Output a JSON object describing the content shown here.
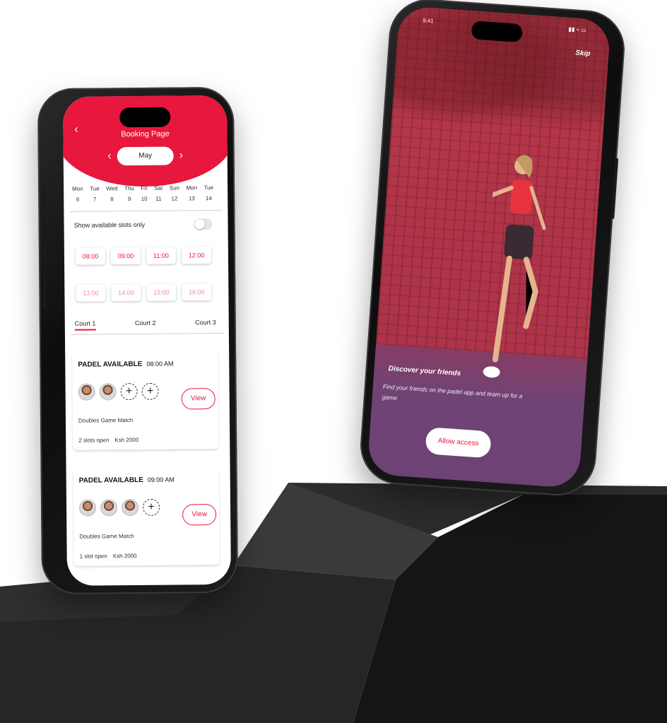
{
  "booking": {
    "title": "Booking Page",
    "back_icon": "chevron-left-icon",
    "month": "May",
    "days": [
      {
        "name": "Mon",
        "num": "6"
      },
      {
        "name": "Tue",
        "num": "7"
      },
      {
        "name": "Wed",
        "num": "8"
      },
      {
        "name": "Thu",
        "num": "9"
      },
      {
        "name": "Fri",
        "num": "10"
      },
      {
        "name": "Sat",
        "num": "11"
      },
      {
        "name": "Sun",
        "num": "12"
      },
      {
        "name": "Mon",
        "num": "13"
      },
      {
        "name": "Tue",
        "num": "14"
      }
    ],
    "show_available_label": "Show available slots only",
    "slots_row1": [
      "08:00",
      "09:00",
      "11:00",
      "12:00"
    ],
    "slots_row2": [
      "13:00",
      "14:00",
      "15:00",
      "16:00"
    ],
    "courts": [
      "Court 1",
      "Court 2",
      "Court 3"
    ],
    "matches": [
      {
        "title": "PADEL AVAILABLE",
        "time": "08:00 AM",
        "view_label": "View",
        "game_type": "Doubles Game Match",
        "slots_open": "2 slots open",
        "price": "Ksh 2000"
      },
      {
        "title": "PADEL AVAILABLE",
        "time": "09:00 AM",
        "view_label": "View",
        "game_type": "Doubles Game Match",
        "slots_open": "1 slot open",
        "price": "Ksh 2000"
      }
    ],
    "accent_color": "#e8173d"
  },
  "onboarding": {
    "status_time": "9:41",
    "skip_label": "Skip",
    "title": "Discover your friends",
    "text": "Find your friends on the padel app and team up for a game",
    "allow_label": "Allow access"
  }
}
